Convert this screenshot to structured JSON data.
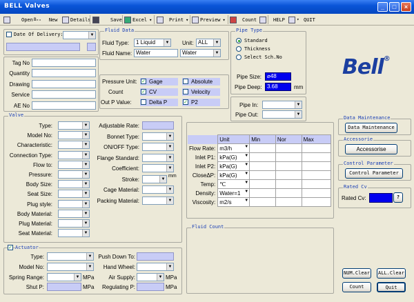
{
  "window": {
    "title": "BELL Valves"
  },
  "toolbar": {
    "open": "Open",
    "new_prefix": "New",
    "details": "Details",
    "save": "Save",
    "excel": "Excel",
    "print": "Print",
    "preview": "Preview",
    "count": "Count",
    "help": "HELP",
    "quit": "QUIT"
  },
  "header": {
    "date_of_delivery_label": "Date Of Delivery:",
    "tag_no": "Tag No",
    "quantity": "Quantity",
    "drawing": "Drawing",
    "service": "Service",
    "ae_no": "AE No"
  },
  "fluid_data": {
    "group": "Fluid Data",
    "fluid_type_label": "Fluid Type:",
    "fluid_type_value": "1 Liquid",
    "unit_label": "Unit:",
    "unit_value": "ALL",
    "fluid_name_label": "Fluid Name:",
    "fluid_name_value": "Water",
    "fluid_name_select": "Water"
  },
  "pressure": {
    "pressure_unit_label": "Pressure Unit:",
    "gage": "Gage",
    "absolute": "Absolute",
    "count_label": "Count",
    "cv": "CV",
    "velocity": "Velocity",
    "outp_label": "Out P Value:",
    "delta_p": "Delta P",
    "p2": "P2"
  },
  "pipe_type": {
    "group": "Pipe Type",
    "standard": "Standard",
    "thickness": "Thickness",
    "select_sch": "Select Sch.No",
    "pipe_size_label": "Pipe Size:",
    "pipe_size_value": "⌀48",
    "pipe_deep_label": "Pipe Deep:",
    "pipe_deep_value": "3.68",
    "pipe_deep_unit": "mm",
    "pipe_in_label": "Pipe In:",
    "pipe_out_label": "Pipe Out:"
  },
  "logo": {
    "text": "Bell",
    "mark": "®"
  },
  "data_maintenance": {
    "group": "Data Maintenance",
    "button": "Data Maintenance"
  },
  "accessories": {
    "group": "Accessorie",
    "button": "Accessorise"
  },
  "control_parameter": {
    "group": "Control Parameter",
    "button": "Control Parameter"
  },
  "rated_cv": {
    "group": "Rated Cv",
    "label": "Rated Cv:",
    "help": "?"
  },
  "valve": {
    "group": "Valve",
    "left": [
      "Type:",
      "Model No:",
      "Characteristic:",
      "Connection Type:",
      "Flow to:",
      "Pressure:",
      "Body Size:",
      "Seat Size:",
      "Plug style:",
      "Body Material:",
      "Plug Material:",
      "Seat Material:"
    ],
    "right": [
      "Adjustable Rate:",
      "Bonnet Type:",
      "ON/OFF Type:",
      "Flange Standard:",
      "Coefficient:",
      "Stroke:",
      "Cage Material:",
      "Packing Material:"
    ],
    "stroke_unit": "mm"
  },
  "flow_table": {
    "headers": [
      "Unit",
      "Min",
      "Nor",
      "Max"
    ],
    "rows": [
      {
        "label": "Flow Rate:",
        "unit": "m3/h"
      },
      {
        "label": "Inlet P1:",
        "unit": "kPa(G)"
      },
      {
        "label": "Inlet P2:",
        "unit": "kPa(G)"
      },
      {
        "label": "CloseΔP:",
        "unit": "kPa(G)"
      },
      {
        "label": "Temp:",
        "unit": "℃"
      },
      {
        "label": "Density:",
        "unit": "Water=1"
      },
      {
        "label": "Viscosity:",
        "unit": "m2/s"
      }
    ]
  },
  "fluid_count": {
    "group": "Fluid Count"
  },
  "actuator": {
    "group": "Actuator",
    "type": "Type:",
    "model_no": "Model No:",
    "spring_range": "Spring Range:",
    "shut_p": "Shut P:",
    "push_down": "Push Down To:",
    "hand_wheel": "Hand Wheel:",
    "air_supply": "Air Supply:",
    "regulating_p": "Regulating P:",
    "mpa": "MPa"
  },
  "footer": {
    "num_clear": "NUM.Clear",
    "all_clear": "ALL.Clear",
    "count": "Count",
    "quit": "Quit"
  }
}
